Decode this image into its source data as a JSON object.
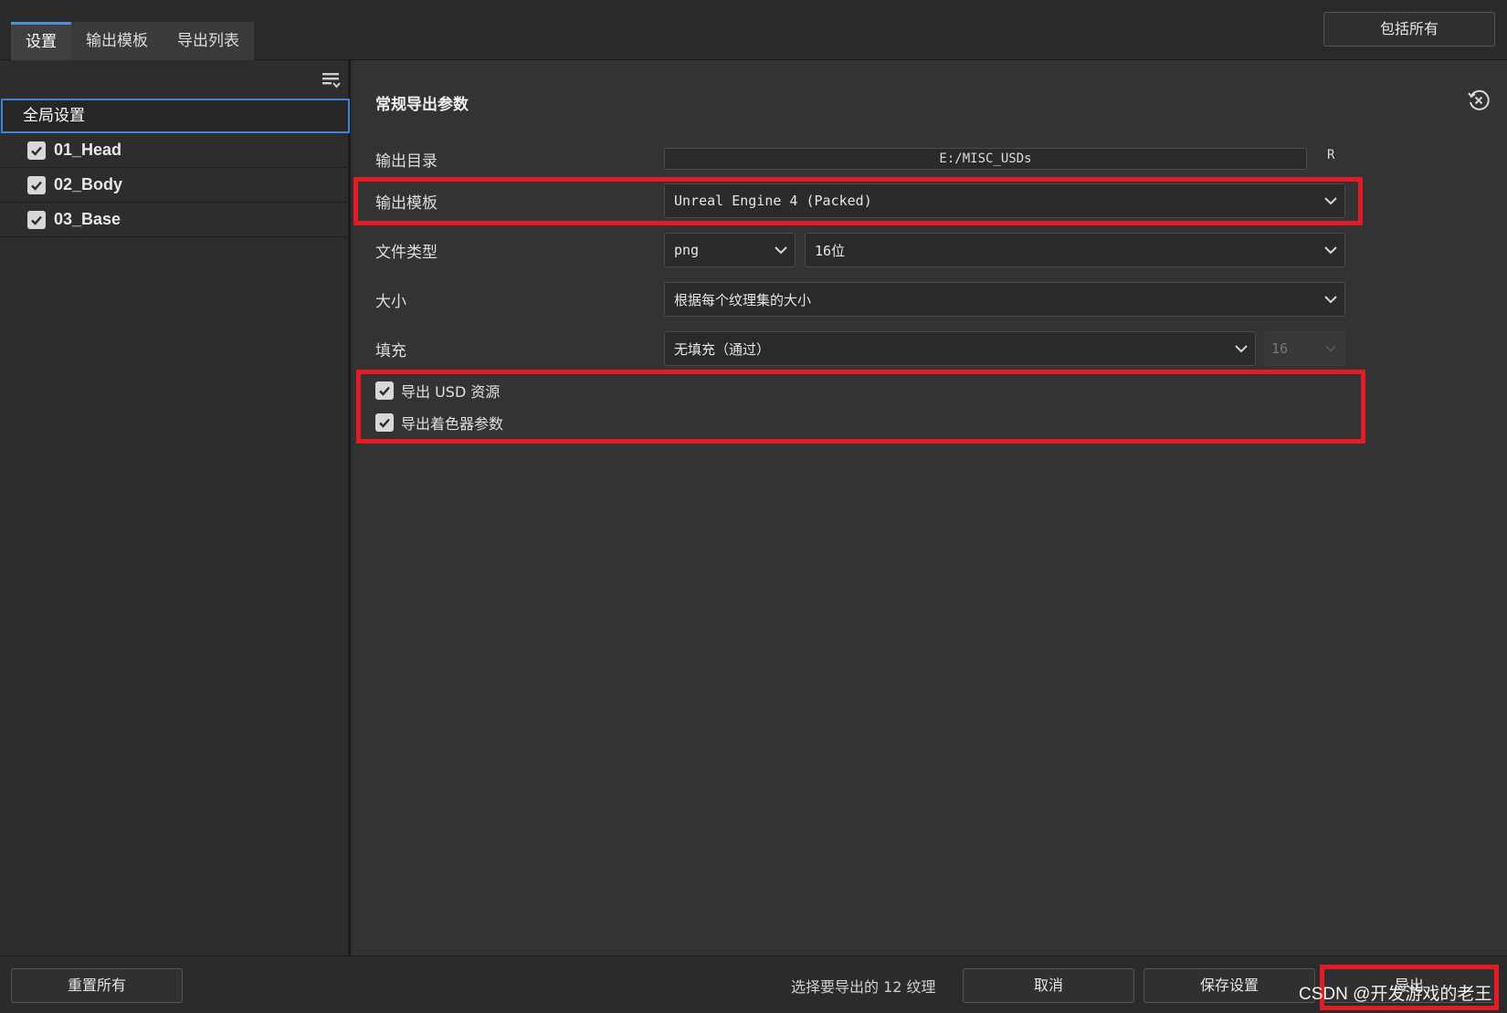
{
  "tabs": [
    {
      "label": "设置",
      "active": true
    },
    {
      "label": "输出模板",
      "active": false
    },
    {
      "label": "导出列表",
      "active": false
    }
  ],
  "header": {
    "include_all_label": "包括所有"
  },
  "left_panel": {
    "global_settings_label": "全局设置",
    "meshes": [
      {
        "label": "01_Head",
        "checked": true
      },
      {
        "label": "02_Body",
        "checked": true
      },
      {
        "label": "03_Base",
        "checked": true
      }
    ]
  },
  "settings": {
    "section_title": "常规导出参数",
    "output_dir": {
      "label": "输出目录",
      "value": "E:/MISC_USDs",
      "r_button": "R"
    },
    "output_template": {
      "label": "输出模板",
      "value": "Unreal Engine 4 (Packed)"
    },
    "file_type": {
      "label": "文件类型",
      "format": "png",
      "bit_depth": "16位"
    },
    "size": {
      "label": "大小",
      "value": "根据每个纹理集的大小"
    },
    "padding": {
      "label": "填充",
      "value": "无填充（通过）",
      "amount": "16"
    },
    "export_usd": {
      "label": "导出 USD 资源",
      "checked": true
    },
    "export_shader_params": {
      "label": "导出着色器参数",
      "checked": true
    }
  },
  "footer": {
    "reset_all_label": "重置所有",
    "status_text": "选择要导出的 12 纹理",
    "cancel_label": "取消",
    "save_settings_label": "保存设置",
    "export_label": "导出",
    "watermark": "CSDN @开发游戏的老王"
  },
  "colors": {
    "highlight": "#e21b25",
    "accent": "#3d84d6",
    "background": "#333333"
  }
}
